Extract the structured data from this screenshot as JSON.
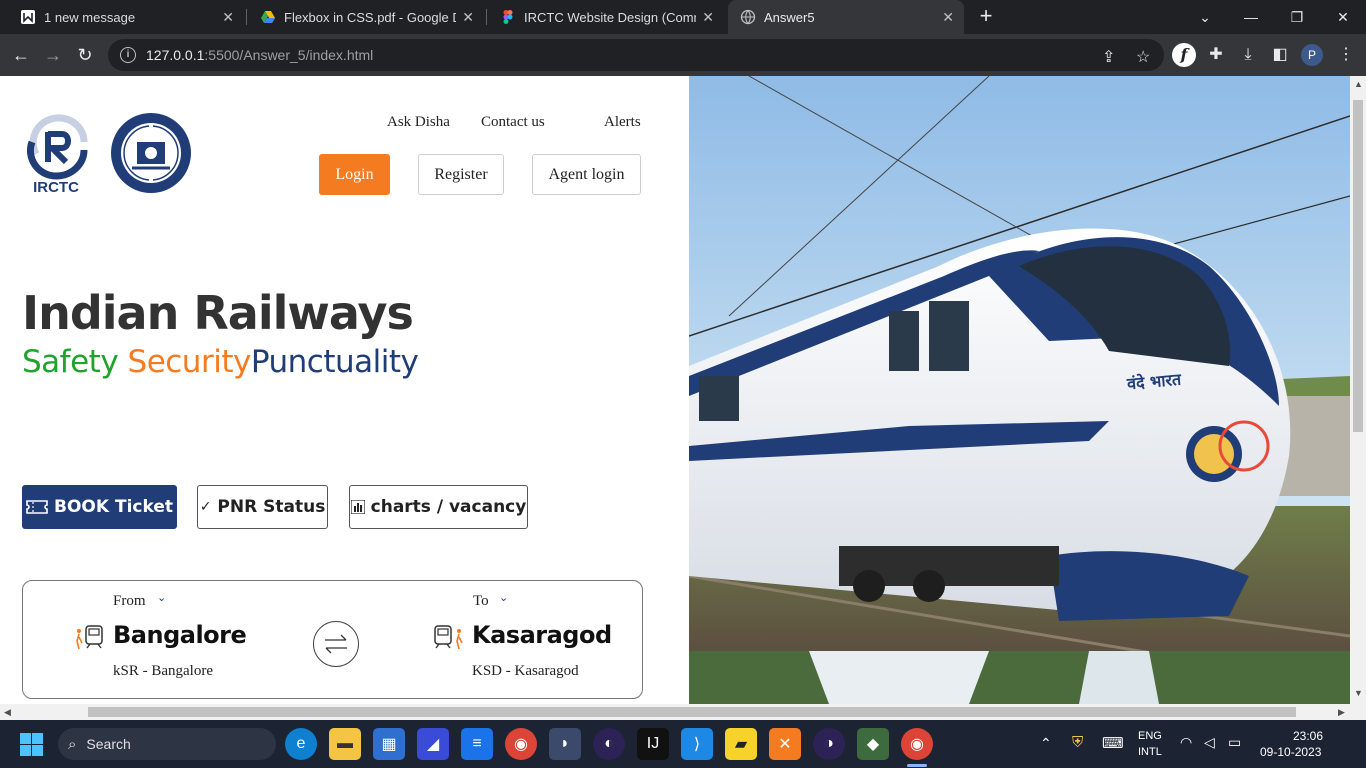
{
  "browser": {
    "tabs": [
      {
        "title": "1 new message",
        "active": false
      },
      {
        "title": "Flexbox in CSS.pdf - Google Driv",
        "active": false
      },
      {
        "title": "IRCTC Website Design (Commun",
        "active": false
      },
      {
        "title": "Answer5",
        "active": true
      }
    ],
    "new_tab": "+",
    "window_controls": {
      "minimize": "—",
      "restore": "❐",
      "close": "✕",
      "tab_search": "⌄"
    },
    "url_host": "127.0.0.1",
    "url_path": ":5500/Answer_5/index.html",
    "profile_initial": "P"
  },
  "header": {
    "logo_text": "IRCTC",
    "top_links": [
      "Ask Disha",
      "Contact us",
      "Alerts"
    ],
    "login": "Login",
    "register": "Register",
    "agent_login": "Agent login"
  },
  "hero": {
    "title": "Indian Railways",
    "tag_safety": "Safety ",
    "tag_security": "Security",
    "tag_punctuality": "Punctuality"
  },
  "services": {
    "book": "BOOK Ticket",
    "pnr": "PNR Status",
    "charts": "charts / vacancy"
  },
  "journey": {
    "from_label": "From",
    "from_city": "Bangalore",
    "from_code": "kSR - Bangalore",
    "to_label": "To",
    "to_city": "Kasaragod",
    "to_code": "KSD - Kasaragod"
  },
  "train_marking": "वंदे भारत",
  "taskbar": {
    "search_placeholder": "Search",
    "lang_top": "ENG",
    "lang_bottom": "INTL",
    "time": "23:06",
    "date": "09-10-2023"
  },
  "colors": {
    "accent_orange": "#f47b20",
    "navy": "#213d77",
    "green": "#1fa32d"
  }
}
